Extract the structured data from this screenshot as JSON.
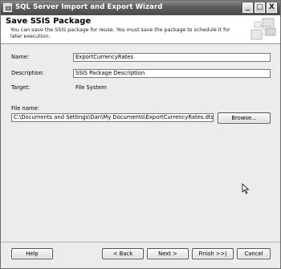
{
  "window": {
    "title": "SQL Server Import and Export Wizard",
    "minimize_glyph": "_",
    "maximize_glyph": "□",
    "close_glyph": "X"
  },
  "header": {
    "title": "Save SSIS Package",
    "description": "You can save the SSIS package for reuse. You must save the package to schedule it for later execution."
  },
  "form": {
    "name_label": "Name:",
    "name_value": "ExportCurrencyRates",
    "description_label": "Description:",
    "description_value": "SSIS Package Description",
    "target_label": "Target:",
    "target_value": "File System",
    "file_name_label": "File name:",
    "file_name_value": "C:\\Documents and Settings\\Dan\\My Documents\\ExportCurrencyRates.dtsx",
    "browse_label": "Browse..."
  },
  "footer": {
    "help_label": "Help",
    "back_label": "< Back",
    "next_label": "Next >",
    "finish_label": "Finish >>|",
    "cancel_label": "Cancel"
  },
  "icons": {
    "title_icon": "wizard-app-icon",
    "header_graphic": "wizard-header-graphic",
    "cursor": "mouse-pointer-icon"
  }
}
